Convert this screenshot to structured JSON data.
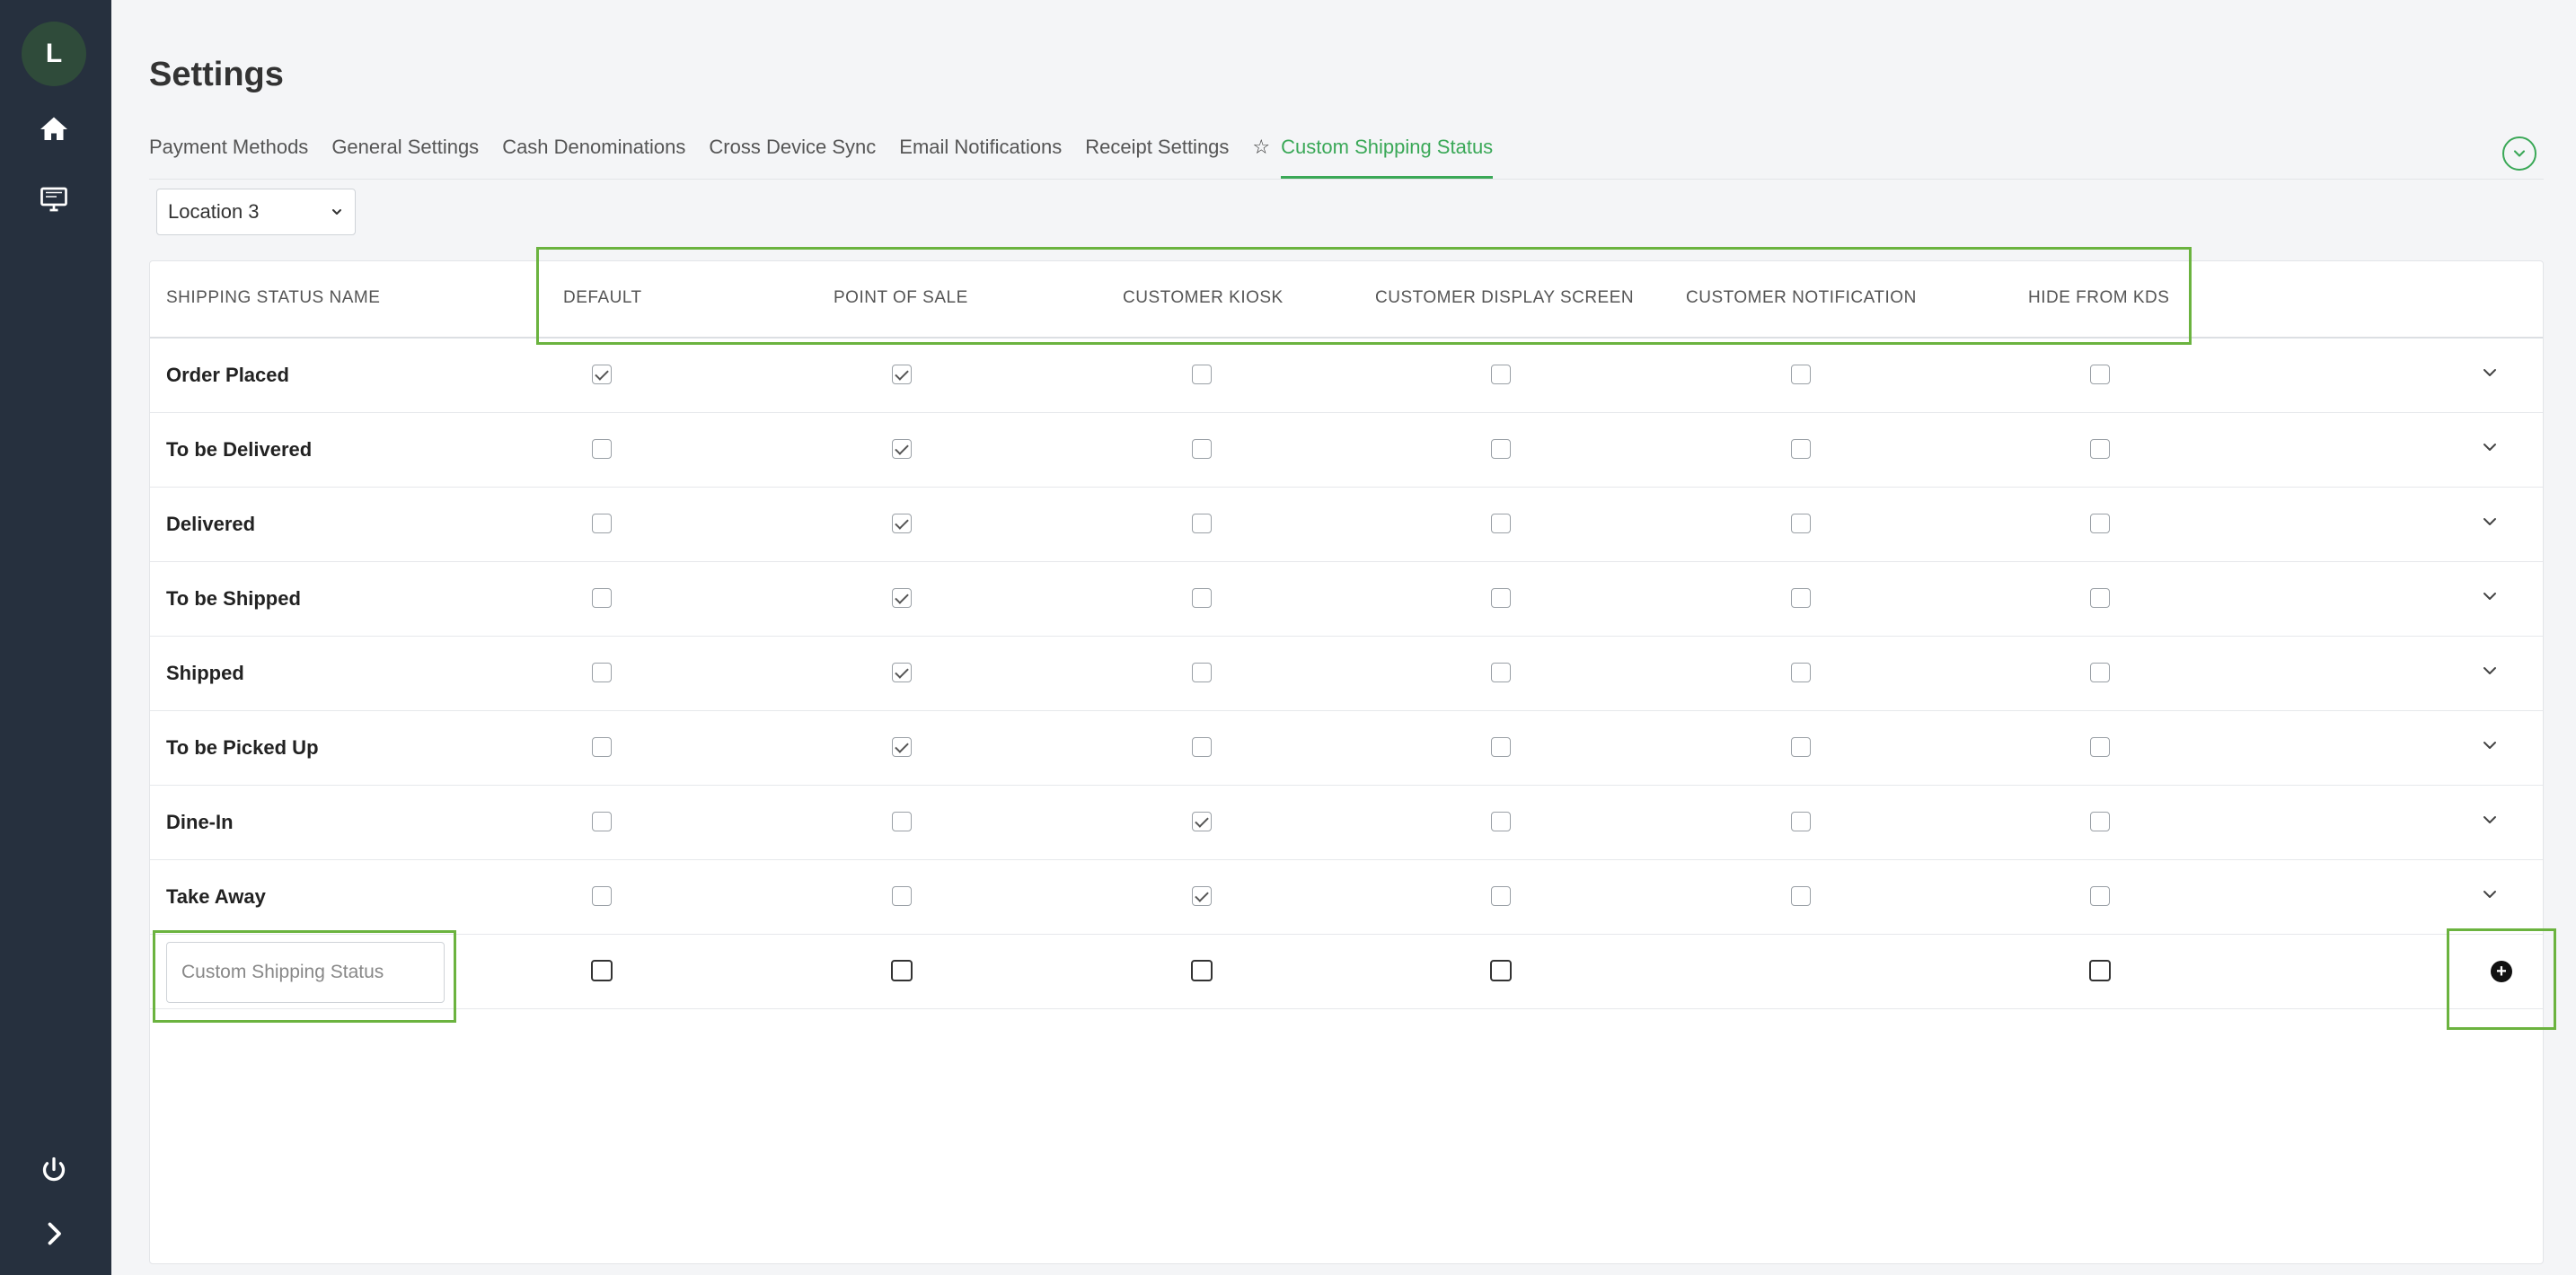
{
  "sidebar": {
    "avatar_letter": "L",
    "items": [
      {
        "icon": "home-icon"
      },
      {
        "icon": "monitor-icon"
      },
      {
        "icon": "power-icon"
      },
      {
        "icon": "chevron-right-icon"
      }
    ]
  },
  "header": {
    "title": "Settings",
    "tabs": [
      {
        "label": "Payment Methods",
        "active": false
      },
      {
        "label": "General Settings",
        "active": false
      },
      {
        "label": "Cash Denominations",
        "active": false
      },
      {
        "label": "Cross Device Sync",
        "active": false
      },
      {
        "label": "Email Notifications",
        "active": false
      },
      {
        "label": "Receipt Settings",
        "active": false
      },
      {
        "label": "Custom Shipping Status",
        "active": true,
        "icon": "star-icon"
      }
    ]
  },
  "location_select": {
    "value": "Location 3"
  },
  "table": {
    "columns": [
      "SHIPPING STATUS NAME",
      "DEFAULT",
      "POINT OF SALE",
      "CUSTOMER KIOSK",
      "CUSTOMER DISPLAY SCREEN",
      "CUSTOMER NOTIFICATION",
      "HIDE FROM KDS"
    ],
    "rows": [
      {
        "name": "Order Placed",
        "values": [
          true,
          true,
          false,
          false,
          false,
          false
        ]
      },
      {
        "name": "To be Delivered",
        "values": [
          false,
          true,
          false,
          false,
          false,
          false
        ]
      },
      {
        "name": "Delivered",
        "values": [
          false,
          true,
          false,
          false,
          false,
          false
        ]
      },
      {
        "name": "To be Shipped",
        "values": [
          false,
          true,
          false,
          false,
          false,
          false
        ]
      },
      {
        "name": "Shipped",
        "values": [
          false,
          true,
          false,
          false,
          false,
          false
        ]
      },
      {
        "name": "To be Picked Up",
        "values": [
          false,
          true,
          false,
          false,
          false,
          false
        ]
      },
      {
        "name": "Dine-In",
        "values": [
          false,
          false,
          true,
          false,
          false,
          false
        ]
      },
      {
        "name": "Take Away",
        "values": [
          false,
          false,
          true,
          false,
          false,
          false
        ]
      }
    ],
    "new_row": {
      "placeholder": "Custom Shipping Status",
      "checkbox_columns": [
        0,
        1,
        2,
        3,
        5
      ]
    }
  },
  "colors": {
    "accent": "#3aa857",
    "sidebar": "#26303e",
    "highlight": "#6bb33f"
  }
}
